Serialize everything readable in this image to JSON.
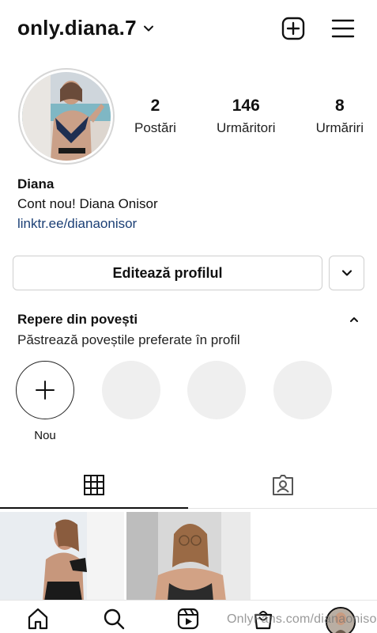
{
  "header": {
    "username": "only.diana.7",
    "icons": [
      "chevron-down-icon",
      "plus-square-icon",
      "hamburger-menu-icon"
    ]
  },
  "profile": {
    "stats": [
      {
        "value": "2",
        "label": "Postări"
      },
      {
        "value": "146",
        "label": "Urmăritori"
      },
      {
        "value": "8",
        "label": "Urmăriri"
      }
    ],
    "name": "Diana",
    "bio": "Cont nou! Diana Onisor",
    "link": "linktr.ee/dianaonisor"
  },
  "actions": {
    "edit_label": "Editează profilul",
    "more_icon": "chevron-down-icon"
  },
  "highlights": {
    "title": "Repere din povești",
    "subtitle": "Păstrează poveștile preferate în profil",
    "new_label": "Nou",
    "empty_count": 3
  },
  "tabs": [
    {
      "icon": "grid-icon",
      "active": true
    },
    {
      "icon": "tagged-person-icon",
      "active": false
    }
  ],
  "bottom_nav": [
    "home-icon",
    "search-icon",
    "reels-icon",
    "shop-icon",
    "profile-avatar"
  ],
  "watermark": "OnlyFans.com/dianaonisor7",
  "colors": {
    "link": "#1b3f75",
    "border": "#cfcfcf",
    "placeholder": "#efefef"
  }
}
